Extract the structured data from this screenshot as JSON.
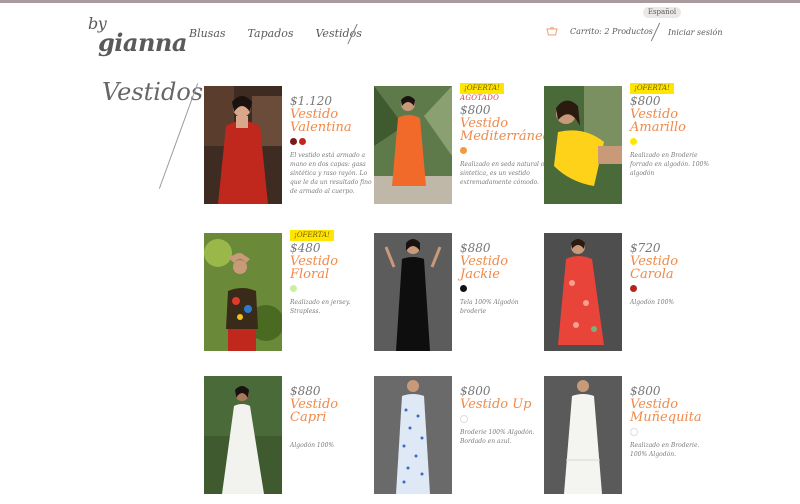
{
  "brand": {
    "by": "by",
    "name": "gianna"
  },
  "nav": [
    "Blusas",
    "Tapados",
    "Vestidos"
  ],
  "language": "Español",
  "cart": {
    "label": "Carrito:  2 Productos"
  },
  "login": "Iniciar sesión",
  "page_title": "Vestidos",
  "colors": {
    "accent": "#f08a4b",
    "offer": "#ffe600",
    "topbar": "#a99a9e"
  },
  "products": [
    {
      "price": "$1.120",
      "name": "Vestido Valentina",
      "offer": "",
      "sold": "",
      "swatches": [
        "#7a1a1a",
        "#c0281e"
      ],
      "desc": "El vestido está armado a mano en dos capas: gasa sintética y raso rayón. Lo que le da un resultado fino de armado al cuerpo."
    },
    {
      "price": "$800",
      "name": "Vestido Mediterráneo",
      "offer": "¡OFERTA!",
      "sold": "AGOTADO",
      "swatches": [
        "#f39a3a"
      ],
      "desc": "Realizado en seda natural o sintetica, es un vestido extremadamente cómodo."
    },
    {
      "price": "$800",
      "name": "Vestido Amarillo",
      "offer": "¡OFERTA!",
      "sold": "",
      "swatches": [
        "#ffe600"
      ],
      "desc": "Realizado en Broderie forrado en algodón. 100% algodón"
    },
    {
      "price": "$480",
      "name": "Vestido Floral",
      "offer": "¡OFERTA!",
      "sold": "",
      "swatches": [
        "#c9f0a0"
      ],
      "desc": " Realizado en jersey. Strapless."
    },
    {
      "price": "$880",
      "name": "Vestido Jackie",
      "offer": "",
      "sold": "",
      "swatches": [
        "#111111"
      ],
      "desc": "Tela 100% Algodón broderie"
    },
    {
      "price": "$720",
      "name": "Vestido Carola",
      "offer": "",
      "sold": "",
      "swatches": [
        "#b5241e"
      ],
      "desc": "Algodón 100%"
    },
    {
      "price": "$880",
      "name": "Vestido Capri",
      "offer": "",
      "sold": "",
      "swatches": [
        "#ffffff"
      ],
      "desc": "Algodón 100%"
    },
    {
      "price": "$800",
      "name": "Vestido Up",
      "offer": "",
      "sold": "",
      "swatches": [
        "#ffffff",
        "#ffffff"
      ],
      "desc": "Broderie  100% Algodón. Bordado en azul."
    },
    {
      "price": "$800",
      "name": "Vestido Muñequita",
      "offer": "",
      "sold": "",
      "swatches": [
        "#ffffff"
      ],
      "desc": "Realizado en Broderie. 100% Algodón."
    }
  ]
}
